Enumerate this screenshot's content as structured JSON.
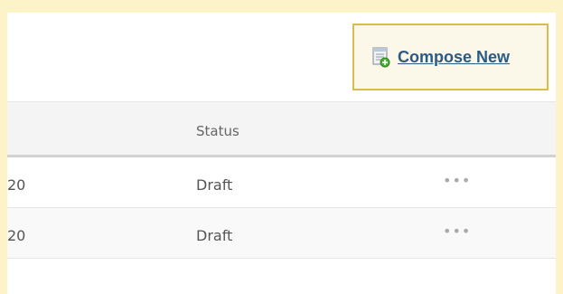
{
  "toolbar": {
    "compose_label": "Compose New",
    "compose_icon": "compose-document-icon"
  },
  "table": {
    "columns": [
      "Status"
    ],
    "rows": [
      {
        "date_fragment": "20",
        "status": "Draft",
        "menu": "•••"
      },
      {
        "date_fragment": "20",
        "status": "Draft",
        "menu": "•••"
      }
    ]
  },
  "colors": {
    "page_background": "#fdf3c8",
    "highlight_border": "#d7bd4c",
    "link": "#2c5a83"
  }
}
